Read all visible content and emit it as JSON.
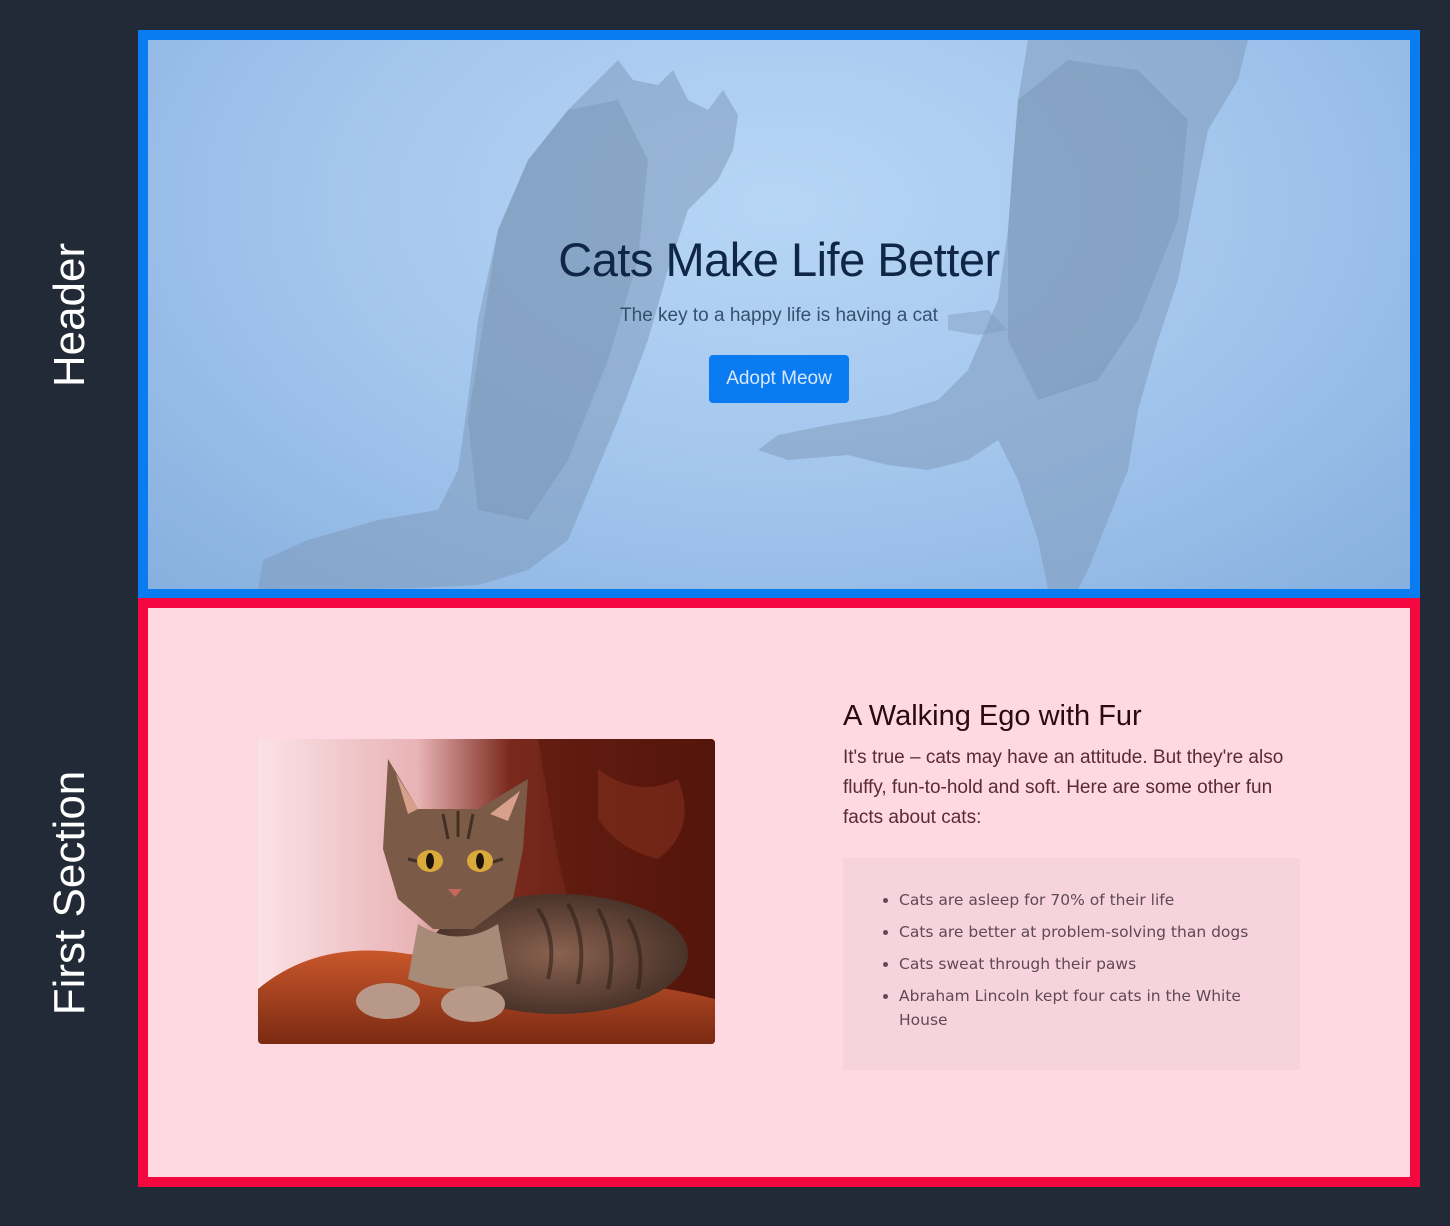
{
  "labels": {
    "header": "Header",
    "first_section": "First Section"
  },
  "header": {
    "title": "Cats Make Life Better",
    "subtitle": "The key to a happy life is having a cat",
    "button_label": "Adopt Meow"
  },
  "first_section": {
    "heading": "A Walking Ego with Fur",
    "paragraph": "It's true – cats may have an attitude. But they're also fluffy, fun-to-hold and soft. Here are some other fun facts about cats:",
    "facts": [
      "Cats are asleep for 70% of their life",
      "Cats are better at problem-solving than dogs",
      "Cats sweat through their paws",
      "Abraham Lincoln kept four cats in the White House"
    ]
  },
  "colors": {
    "page_background": "#232a37",
    "header_border": "#0a7cf2",
    "section_border": "#f5073f",
    "section_background": "#fed9e1",
    "button_background": "#0a7bf1"
  }
}
